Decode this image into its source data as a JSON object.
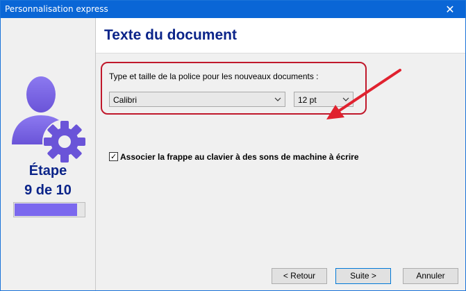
{
  "window": {
    "title": "Personnalisation express",
    "close_glyph": "✕"
  },
  "colors": {
    "titlebar": "#0a66d6",
    "accent_text": "#0b2489",
    "progress_fill": "#7b68ee",
    "highlight_border": "#c0182b"
  },
  "sidebar": {
    "icon": "user-gear-icon",
    "step_label": "Étape",
    "step_count": "9 de 10",
    "progress": {
      "current": 9,
      "total": 10,
      "fraction": 0.9
    }
  },
  "page": {
    "title": "Texte du document"
  },
  "font_settings": {
    "label": "Type et taille de la police pour les nouveaux documents :",
    "font_value": "Calibri",
    "size_value": "12 pt"
  },
  "options": {
    "typewriter_sounds_label": "Associer la frappe au clavier à des sons de machine à écrire",
    "typewriter_sounds_checked": true,
    "check_glyph": "✓"
  },
  "buttons": {
    "back": "< Retour",
    "next": "Suite >",
    "cancel": "Annuler"
  }
}
